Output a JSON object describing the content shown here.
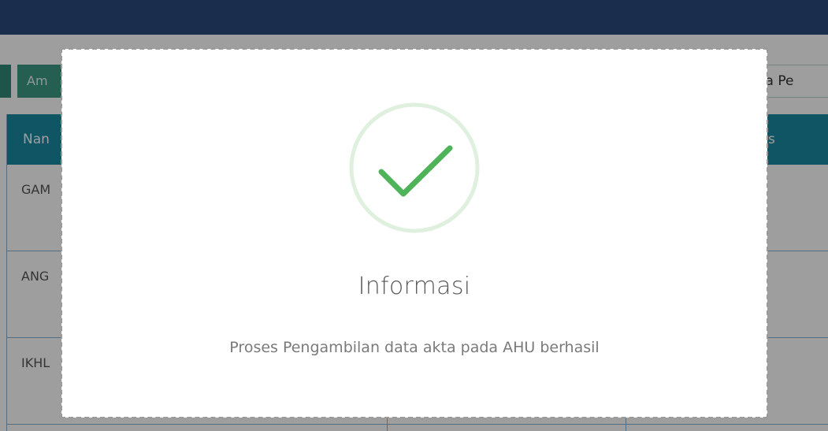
{
  "toolbar": {
    "primary_button_label": "Am",
    "sort_label": "ma Pe"
  },
  "table": {
    "header_first_col": "Nan",
    "header_last_col": "s",
    "rows": [
      {
        "name": "GAM"
      },
      {
        "name": "ANG"
      },
      {
        "name": "IKHL"
      }
    ]
  },
  "dialog": {
    "icon": "success-check-icon",
    "title": "Informasi",
    "message": "Proses Pengambilan data akta pada AHU berhasil"
  },
  "colors": {
    "topbar": "#2d4a7d",
    "table_header": "#1a8aa2",
    "primary_button": "#3a9a84",
    "success_green": "#4fb35a",
    "success_ring": "#dff0df"
  }
}
